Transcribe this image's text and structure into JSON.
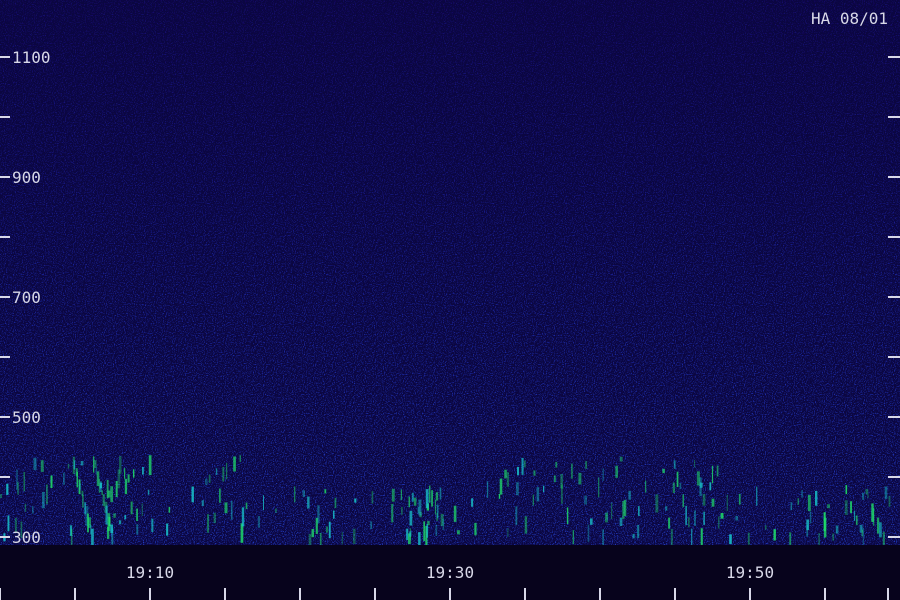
{
  "chart_data": {
    "type": "heatmap",
    "title": "HA 08/01",
    "xlabel": "",
    "ylabel": "",
    "x_ticks_labeled": [
      "19:10",
      "19:30",
      "19:50"
    ],
    "x_tick_minutes": [
      19.05,
      19.1,
      19.15,
      19.2,
      19.25,
      19.3,
      19.35,
      19.4,
      19.45,
      19.5,
      19.55
    ],
    "y_ticks_labeled": [
      300,
      500,
      700,
      900,
      1100
    ],
    "y_tick_values": [
      300,
      400,
      500,
      600,
      700,
      800,
      900,
      1000,
      1100
    ],
    "ylim": [
      300,
      1100
    ],
    "colors": {
      "background": "#000000",
      "low": "#1a0a70",
      "mid": "#2a4ff0",
      "high": "#1fe06a",
      "text": "#d8d8e8"
    },
    "grid": false
  }
}
